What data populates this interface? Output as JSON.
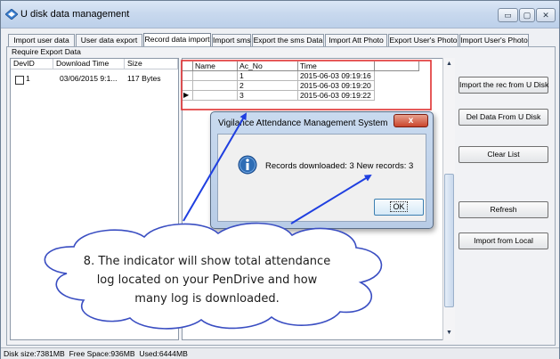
{
  "window": {
    "title": "U disk data management",
    "controls": {
      "minimize": "▭",
      "maximize": "▢",
      "close": "✕"
    }
  },
  "tabs": [
    {
      "label": "Import user data"
    },
    {
      "label": "User data export"
    },
    {
      "label": "Record data import",
      "active": true
    },
    {
      "label": "Import sms"
    },
    {
      "label": "Export the sms Data"
    },
    {
      "label": "Import Att Photo"
    },
    {
      "label": "Export User's Photo"
    },
    {
      "label": "Import User's Photo"
    }
  ],
  "group_label": "Require Export Data",
  "left_list": {
    "columns": [
      "DevID",
      "Download Time",
      "Size"
    ],
    "rows": [
      {
        "devid": "1",
        "download_time": "03/06/2015 9:1...",
        "size": "117 Bytes"
      }
    ]
  },
  "grid": {
    "columns": [
      "Name",
      "Ac_No",
      "Time"
    ],
    "rows": [
      {
        "name": "",
        "ac_no": "1",
        "time": "2015-06-03 09:19:16"
      },
      {
        "name": "",
        "ac_no": "2",
        "time": "2015-06-03 09:19:20"
      },
      {
        "name": "",
        "ac_no": "3",
        "time": "2015-06-03 09:19:22"
      }
    ],
    "current_row_marker": "▶"
  },
  "buttons": {
    "import_from_u_disk": "Import the rec from U Disk",
    "del_from_u_disk": "Del Data From U Disk",
    "clear_list": "Clear List",
    "refresh": "Refresh",
    "import_from_local": "Import from Local"
  },
  "status": {
    "disk_size": "Disk size:7381MB",
    "free_space": "Free Space:936MB",
    "used": "Used:6444MB"
  },
  "dialog": {
    "title": "Vigilance Attendance Management System",
    "message": "Records downloaded: 3 New records: 3",
    "ok_label": "OK",
    "close_glyph": "x",
    "icon": "info-icon"
  },
  "callout": {
    "lines": [
      "8. The indicator will show total attendance",
      "log located on your PenDrive and how",
      "many log is downloaded."
    ]
  },
  "colors": {
    "highlight_box": "#e03030",
    "arrow": "#1f3fe0",
    "info_icon": "#2f6db5"
  }
}
